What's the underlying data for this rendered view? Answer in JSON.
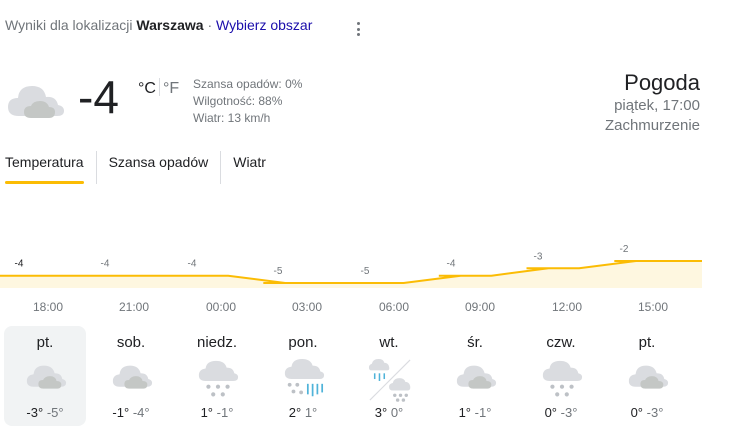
{
  "location": {
    "prefix": "Wyniki dla lokalizacji",
    "city": "Warszawa",
    "separator": "·",
    "change_link": "Wybierz obszar"
  },
  "current": {
    "icon": "cloud-icon",
    "temp": "-4",
    "unit_c": "°C",
    "unit_f": "°F",
    "precip": "Szansa opadów: 0%",
    "humidity": "Wilgotność: 88%",
    "wind": "Wiatr: 13 km/h"
  },
  "summary": {
    "title": "Pogoda",
    "datetime": "piątek, 17:00",
    "condition": "Zachmurzenie"
  },
  "tabs": [
    {
      "label": "Temperatura",
      "active": true
    },
    {
      "label": "Szansa opadów",
      "active": false
    },
    {
      "label": "Wiatr",
      "active": false
    }
  ],
  "colors": {
    "accent": "#fbbc04",
    "fill": "#fef7e0",
    "link": "#1a0dab"
  },
  "chart_data": {
    "type": "area",
    "x": [
      "18:00",
      "21:00",
      "00:00",
      "03:00",
      "06:00",
      "09:00",
      "12:00",
      "15:00"
    ],
    "values": [
      -4,
      -4,
      -4,
      -5,
      -5,
      -4,
      -3,
      -2
    ],
    "labels": [
      "-4",
      "-4",
      "-4",
      "-5",
      "-5",
      "-4",
      "-3",
      "-2"
    ],
    "ylim": [
      -5,
      -2
    ],
    "title": "",
    "xlabel": "",
    "ylabel": ""
  },
  "days": [
    {
      "name": "pt.",
      "icon": "cloud-icon",
      "hi": "-3°",
      "lo": "-5°",
      "selected": true
    },
    {
      "name": "sob.",
      "icon": "cloud-icon",
      "hi": "-1°",
      "lo": "-4°",
      "selected": false
    },
    {
      "name": "niedz.",
      "icon": "snow-icon",
      "hi": "1°",
      "lo": "-1°",
      "selected": false
    },
    {
      "name": "pon.",
      "icon": "rain-snow-icon",
      "hi": "2°",
      "lo": "1°",
      "selected": false
    },
    {
      "name": "wt.",
      "icon": "rain-then-snow-icon",
      "hi": "3°",
      "lo": "0°",
      "selected": false
    },
    {
      "name": "śr.",
      "icon": "cloud-icon",
      "hi": "1°",
      "lo": "-1°",
      "selected": false
    },
    {
      "name": "czw.",
      "icon": "snow-icon",
      "hi": "0°",
      "lo": "-3°",
      "selected": false
    },
    {
      "name": "pt.",
      "icon": "cloud-icon",
      "hi": "0°",
      "lo": "-3°",
      "selected": false
    }
  ]
}
